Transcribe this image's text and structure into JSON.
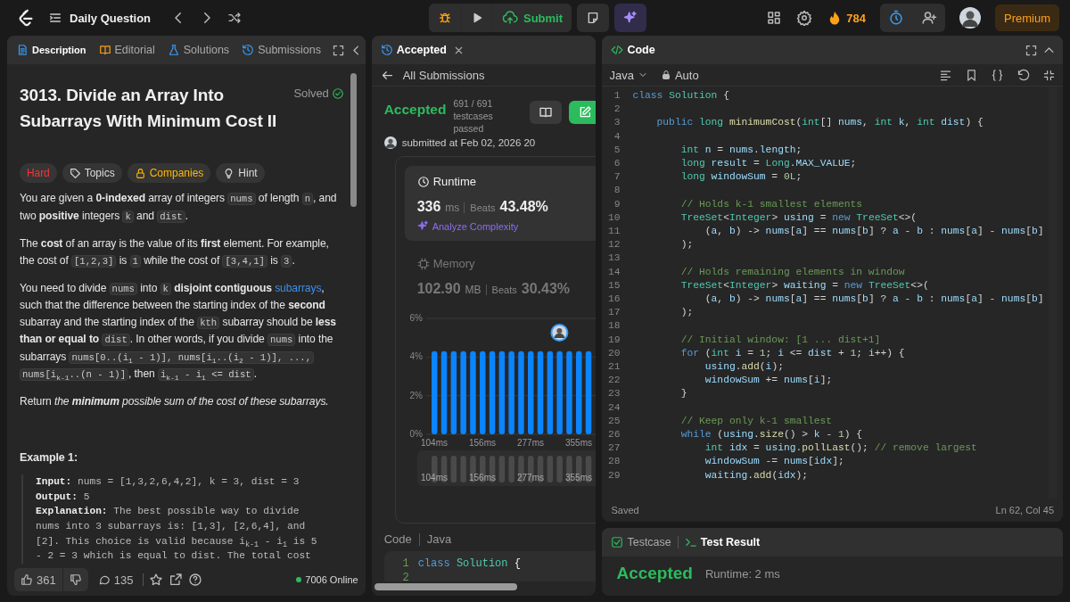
{
  "top_bar": {
    "title": "Daily Question",
    "submit": "Submit",
    "streak": "784",
    "premium": "Premium"
  },
  "description_panel": {
    "tabs": [
      {
        "label": "Description",
        "selected": true
      },
      {
        "label": "Editorial",
        "selected": false
      },
      {
        "label": "Solutions",
        "selected": false
      },
      {
        "label": "Submissions",
        "selected": false
      }
    ],
    "title": "3013. Divide an Array Into Subarrays With Minimum Cost II",
    "status": "Solved",
    "tags": [
      {
        "label": "Hard",
        "kind": "difficulty"
      },
      {
        "label": "Topics",
        "kind": "topics"
      },
      {
        "label": "Companies",
        "kind": "companies"
      },
      {
        "label": "Hint",
        "kind": "hint"
      }
    ],
    "paragraphs": [
      [
        {
          "kind": "text",
          "text": "You are given a **0-indexed** array of integers "
        },
        {
          "kind": "code",
          "text": "nums"
        },
        {
          "kind": "text",
          "text": " of length "
        },
        {
          "kind": "code",
          "text": "n"
        },
        {
          "kind": "text",
          "text": ", and two **positive** integers "
        },
        {
          "kind": "code",
          "text": "k"
        },
        {
          "kind": "text",
          "text": " and "
        },
        {
          "kind": "code",
          "text": "dist"
        },
        {
          "kind": "text",
          "text": "."
        }
      ],
      [
        {
          "kind": "text",
          "text": "The **cost** of an array is the value of its **first** element. For example, the cost of "
        },
        {
          "kind": "code",
          "text": "[1,2,3]"
        },
        {
          "kind": "text",
          "text": " is "
        },
        {
          "kind": "code",
          "text": "1"
        },
        {
          "kind": "text",
          "text": " while the cost of "
        },
        {
          "kind": "code",
          "text": "[3,4,1]"
        },
        {
          "kind": "text",
          "text": " is "
        },
        {
          "kind": "code",
          "text": "3"
        },
        {
          "kind": "text",
          "text": "."
        }
      ],
      [
        {
          "kind": "text",
          "text": "You need to divide "
        },
        {
          "kind": "code",
          "text": "nums"
        },
        {
          "kind": "text",
          "text": " into "
        },
        {
          "kind": "code",
          "text": "k"
        },
        {
          "kind": "text",
          "text": " **disjoint contiguous** "
        },
        {
          "kind": "link",
          "text": "subarrays"
        },
        {
          "kind": "text",
          "text": ", such that the difference between the starting index of the **second** subarray and the starting index of the "
        },
        {
          "kind": "code",
          "text": "kth"
        },
        {
          "kind": "text",
          "text": " subarray should be **less than or equal to** "
        },
        {
          "kind": "code",
          "text": "dist"
        },
        {
          "kind": "text",
          "text": ". In other words, if you divide "
        },
        {
          "kind": "code",
          "text": "nums"
        },
        {
          "kind": "text",
          "text": " into the subarrays "
        },
        {
          "kind": "code",
          "text": "nums[0..(i$_{1}$ - 1)], nums[i$_{1}$..(i$_{2}$ - 1)], ..., nums[i$_{k-1}$..(n - 1)]"
        },
        {
          "kind": "text",
          "text": ", then "
        },
        {
          "kind": "code",
          "text": "i$_{k-1}$ - i$_{1}$ <= dist"
        },
        {
          "kind": "text",
          "text": "."
        }
      ],
      [
        {
          "kind": "text",
          "text": "Return "
        },
        {
          "kind": "emphasis",
          "text": "the **minimum** possible sum of the cost of these subarrays."
        }
      ]
    ],
    "example": {
      "heading": "Example 1:",
      "lines": [
        "**Input:** nums = [1,3,2,6,4,2], k = 3, dist = 3",
        "**Output:** 5",
        "**Explanation:** The best possible way to divide",
        "nums into 3 subarrays is: [1,3], [2,6,4], and",
        "[2]. This choice is valid because i$_{k-1}$ - i$_{1}$ is 5",
        "- 2 = 3 which is equal to dist. The total cost"
      ]
    },
    "footer": {
      "likes": "361",
      "comments": "135",
      "online": "7006 Online"
    }
  },
  "submission_panel": {
    "tab": "Accepted",
    "back": "All Submissions",
    "status": "Accepted",
    "testcases": "691 / 691 testcases passed",
    "submitted": "submitted at Feb 02, 2026 20",
    "metrics": [
      {
        "kind": "runtime",
        "label": "Runtime",
        "value": "336",
        "unit": "ms",
        "beats_label": "Beats",
        "beats": "43.48%",
        "analyze": "Analyze Complexity",
        "selected": true
      },
      {
        "kind": "memory",
        "label": "Memory",
        "value": "102.90",
        "unit": "MB",
        "beats_label": "Beats",
        "beats": "30.43%",
        "selected": false
      }
    ],
    "chart_data": {
      "type": "bar",
      "categories": [
        "104ms",
        null,
        null,
        null,
        null,
        "156ms",
        null,
        null,
        null,
        null,
        "277ms",
        null,
        null,
        null,
        null,
        "355ms",
        null
      ],
      "values": [
        4.3,
        4.3,
        4.3,
        4.3,
        4.3,
        4.3,
        4.3,
        4.3,
        4.3,
        4.3,
        4.3,
        4.3,
        4.3,
        4.3,
        4.3,
        4.3,
        4.3
      ],
      "ylim": [
        0,
        6
      ],
      "yticks": [
        {
          "value": 0,
          "label": "0%"
        },
        {
          "value": 2,
          "label": "2%"
        },
        {
          "value": 4,
          "label": "4%"
        },
        {
          "value": 6,
          "label": "6%"
        }
      ]
    },
    "overview_labels": [
      "104ms",
      "156ms",
      "277ms",
      "355ms"
    ],
    "code_label": "Code",
    "language": "Java",
    "code_lines": [
      {
        "n": "1",
        "code": "class Solution {"
      },
      {
        "n": "2"
      }
    ]
  },
  "code_panel": {
    "title": "Code",
    "language": "Java",
    "mode": "Auto",
    "lines": [
      {
        "n": "1",
        "code": "class Solution {"
      },
      {
        "n": "2"
      },
      {
        "n": "3",
        "code": "    public long minimumCost(int[] nums, int k, int dist) {"
      },
      {
        "n": "4"
      },
      {
        "n": "5",
        "code": "        int n = nums.length;"
      },
      {
        "n": "6",
        "code": "        long result = Long.MAX_VALUE;"
      },
      {
        "n": "7",
        "code": "        long windowSum = 0L;"
      },
      {
        "n": "8"
      },
      {
        "n": "9",
        "code": "        // Holds k-1 smallest elements"
      },
      {
        "n": "10",
        "code": "        TreeSet<Integer> using = new TreeSet<>("
      },
      {
        "n": "11",
        "code": "            (a, b) -> nums[a] == nums[b] ? a - b : nums[a] - nums[b]"
      },
      {
        "n": "12",
        "code": "        );"
      },
      {
        "n": "13"
      },
      {
        "n": "14",
        "code": "        // Holds remaining elements in window"
      },
      {
        "n": "15",
        "code": "        TreeSet<Integer> waiting = new TreeSet<>("
      },
      {
        "n": "16",
        "code": "            (a, b) -> nums[a] == nums[b] ? a - b : nums[a] - nums[b]"
      },
      {
        "n": "17",
        "code": "        );"
      },
      {
        "n": "18"
      },
      {
        "n": "19",
        "code": "        // Initial window: [1 ... dist+1]"
      },
      {
        "n": "20",
        "code": "        for (int i = 1; i <= dist + 1; i++) {"
      },
      {
        "n": "21",
        "code": "            using.add(i);"
      },
      {
        "n": "22",
        "code": "            windowSum += nums[i];"
      },
      {
        "n": "23",
        "code": "        }"
      },
      {
        "n": "24"
      },
      {
        "n": "25",
        "code": "        // Keep only k-1 smallest"
      },
      {
        "n": "26",
        "code": "        while (using.size() > k - 1) {"
      },
      {
        "n": "27",
        "code": "            int idx = using.pollLast(); // remove largest"
      },
      {
        "n": "28",
        "code": "            windowSum -= nums[idx];"
      },
      {
        "n": "29",
        "code": "            waiting.add(idx);"
      }
    ],
    "status": "Saved",
    "cursor": "Ln 62, Col 45"
  },
  "result_panel": {
    "tabs": [
      {
        "label": "Testcase",
        "selected": false
      },
      {
        "label": "Test Result",
        "selected": true
      }
    ],
    "status": "Accepted",
    "runtime": "Runtime: 2 ms"
  }
}
